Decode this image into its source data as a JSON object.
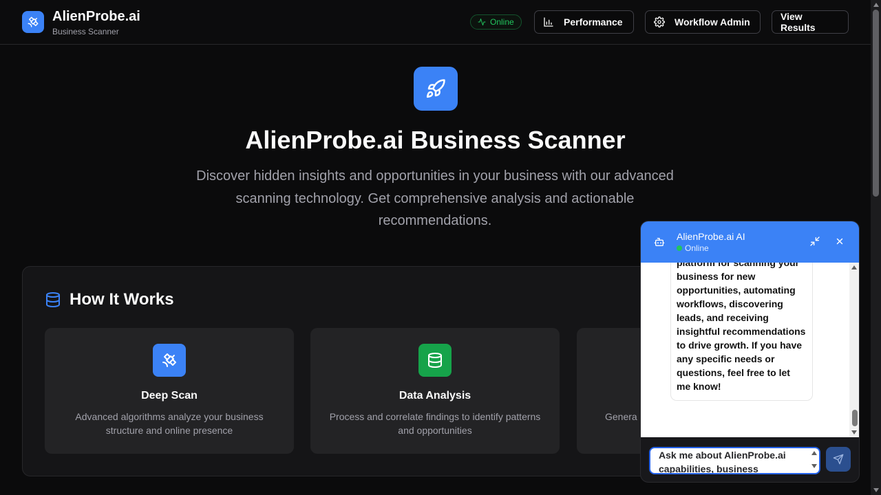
{
  "header": {
    "brand_title": "AlienProbe.ai",
    "brand_subtitle": "Business Scanner",
    "status": "Online",
    "buttons": {
      "performance": "Performance",
      "workflow_admin": "Workflow Admin",
      "view_results": "View Results"
    }
  },
  "hero": {
    "title": "AlienProbe.ai Business Scanner",
    "description": "Discover hidden insights and opportunities in your business with our advanced scanning technology. Get comprehensive analysis and actionable recommendations."
  },
  "how_it_works": {
    "title": "How It Works",
    "features": [
      {
        "title": "Deep Scan",
        "description": "Advanced algorithms analyze your business structure and online presence",
        "color": "#3b82f6"
      },
      {
        "title": "Data Analysis",
        "description": "Process and correlate findings to identify patterns and opportunities",
        "color": "#16a34a"
      },
      {
        "title": "",
        "description": "Genera",
        "color": "#8b5cf6"
      }
    ]
  },
  "chat": {
    "name": "AlienProbe.ai AI",
    "status": "Online",
    "message": "platform for scanning your business for new opportunities, automating workflows, discovering leads, and receiving insightful recommendations to drive growth. If you have any specific needs or questions, feel free to let me know!",
    "input_value": "Ask me about AlienProbe.ai capabilities, business"
  },
  "colors": {
    "accent": "#3b82f6",
    "success": "#22c55e",
    "background": "#0b0b0c"
  }
}
